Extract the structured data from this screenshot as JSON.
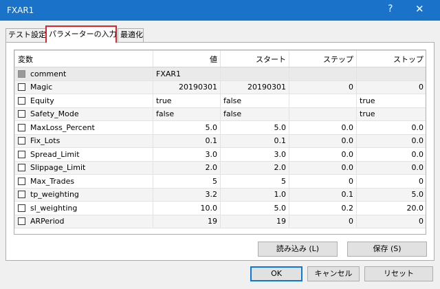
{
  "window": {
    "title": "FXAR1",
    "help": "?",
    "close": "✕"
  },
  "tabs": [
    "テスト設定",
    "パラメーターの入力",
    "最適化"
  ],
  "table": {
    "headers": [
      "変数",
      "値",
      "スタート",
      "ステップ",
      "ストップ"
    ],
    "rows": [
      {
        "name": "comment",
        "value": "FXAR1",
        "start": "",
        "step": "",
        "stop": "",
        "disabled": true
      },
      {
        "name": "Magic",
        "value": "20190301",
        "start": "20190301",
        "step": "0",
        "stop": "0"
      },
      {
        "name": "Equity",
        "value": "true",
        "start": "false",
        "step": "",
        "stop": "true"
      },
      {
        "name": "Safety_Mode",
        "value": "false",
        "start": "false",
        "step": "",
        "stop": "true"
      },
      {
        "name": "MaxLoss_Percent",
        "value": "5.0",
        "start": "5.0",
        "step": "0.0",
        "stop": "0.0"
      },
      {
        "name": "Fix_Lots",
        "value": "0.1",
        "start": "0.1",
        "step": "0.0",
        "stop": "0.0"
      },
      {
        "name": "Spread_Limit",
        "value": "3.0",
        "start": "3.0",
        "step": "0.0",
        "stop": "0.0"
      },
      {
        "name": "Slippage_Limit",
        "value": "2.0",
        "start": "2.0",
        "step": "0.0",
        "stop": "0.0"
      },
      {
        "name": "Max_Trades",
        "value": "5",
        "start": "5",
        "step": "0",
        "stop": "0"
      },
      {
        "name": "tp_weighting",
        "value": "3.2",
        "start": "1.0",
        "step": "0.1",
        "stop": "5.0"
      },
      {
        "name": "sl_weighting",
        "value": "10.0",
        "start": "5.0",
        "step": "0.2",
        "stop": "20.0"
      },
      {
        "name": "ARPeriod",
        "value": "19",
        "start": "19",
        "step": "0",
        "stop": "0"
      }
    ]
  },
  "buttons": {
    "load": "読み込み (L)",
    "save": "保存 (S)",
    "ok": "OK",
    "cancel": "キャンセル",
    "reset": "リセット"
  },
  "colors": {
    "titlebar": "#1a73c9",
    "active_tab_highlight": "#e32128"
  }
}
